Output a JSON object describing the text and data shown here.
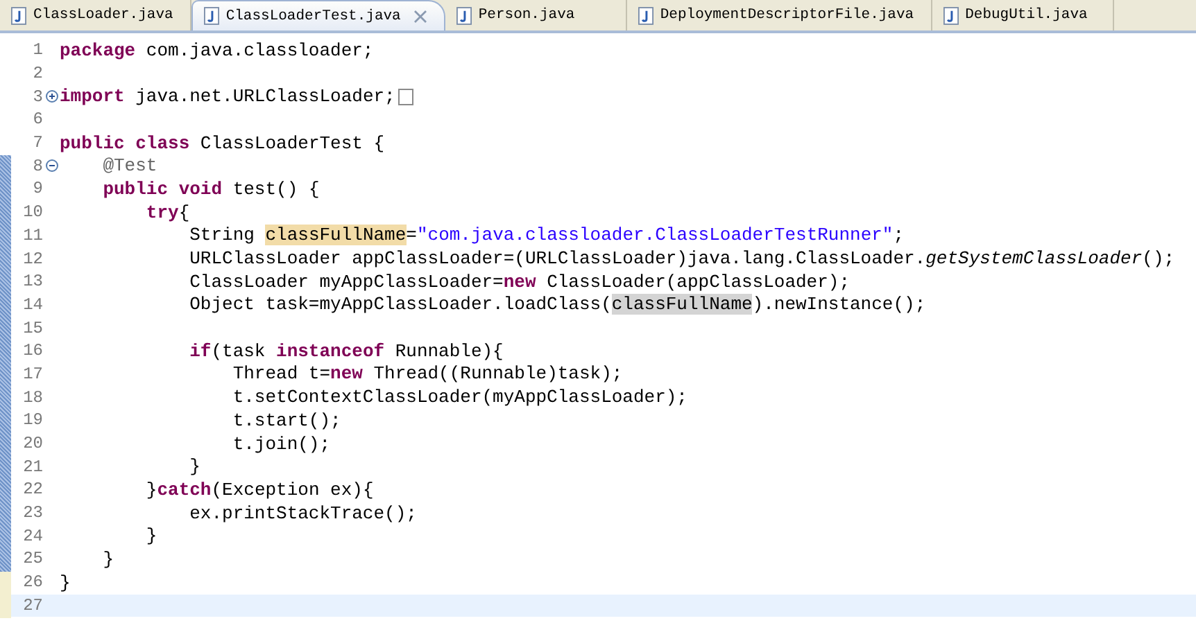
{
  "tabs": [
    {
      "label": "ClassLoader.java",
      "selected": false
    },
    {
      "label": "ClassLoaderTest.java",
      "selected": true
    },
    {
      "label": "Person.java",
      "selected": false
    },
    {
      "label": "DeploymentDescriptorFile.java",
      "selected": false
    },
    {
      "label": "DebugUtil.java",
      "selected": false
    }
  ],
  "editor": {
    "lines": [
      {
        "number": "1",
        "tokens": [
          {
            "kind": "keyword",
            "text": "package"
          },
          {
            "kind": "plain",
            "text": " com.java.classloader;"
          }
        ]
      },
      {
        "number": "2"
      },
      {
        "number": "3",
        "folded": true,
        "folded_marker": true,
        "tokens": [
          {
            "kind": "keyword",
            "text": "import"
          },
          {
            "kind": "plain",
            "text": " java.net.URLClassLoader;"
          }
        ]
      },
      {
        "number": "6"
      },
      {
        "number": "7",
        "tokens": [
          {
            "kind": "keyword",
            "text": "public class"
          },
          {
            "kind": "plain",
            "text": " ClassLoaderTest {"
          }
        ]
      },
      {
        "number": "8",
        "folded": false,
        "tokens": [
          {
            "kind": "annotation",
            "text": "    @Test"
          }
        ]
      },
      {
        "number": "9",
        "tokens": [
          {
            "kind": "keyword",
            "text": "    public void"
          },
          {
            "kind": "plain",
            "text": " test() {"
          }
        ]
      },
      {
        "number": "10",
        "tokens": [
          {
            "kind": "keyword",
            "text": "        try"
          },
          {
            "kind": "plain",
            "text": "{"
          }
        ]
      },
      {
        "number": "11",
        "tokens": [
          {
            "kind": "plain",
            "text": "            String "
          },
          {
            "kind": "occurrence-write",
            "text": "classFullName"
          },
          {
            "kind": "plain",
            "text": "="
          },
          {
            "kind": "string",
            "text": "\"com.java.classloader.ClassLoaderTestRunner\""
          },
          {
            "kind": "plain",
            "text": ";"
          }
        ]
      },
      {
        "number": "12",
        "tokens": [
          {
            "kind": "plain",
            "text": "            URLClassLoader appClassLoader=(URLClassLoader)java.lang.ClassLoader."
          },
          {
            "kind": "static",
            "text": "getSystemClassLoader"
          },
          {
            "kind": "plain",
            "text": "();"
          }
        ]
      },
      {
        "number": "13",
        "tokens": [
          {
            "kind": "plain",
            "text": "            ClassLoader myAppClassLoader="
          },
          {
            "kind": "keyword",
            "text": "new"
          },
          {
            "kind": "plain",
            "text": " ClassLoader(appClassLoader);"
          }
        ]
      },
      {
        "number": "14",
        "tokens": [
          {
            "kind": "plain",
            "text": "            Object task=myAppClassLoader.loadClass("
          },
          {
            "kind": "occurrence-read",
            "text": "classFullName"
          },
          {
            "kind": "plain",
            "text": ").newInstance();"
          }
        ]
      },
      {
        "number": "15"
      },
      {
        "number": "16",
        "tokens": [
          {
            "kind": "keyword",
            "text": "            if"
          },
          {
            "kind": "plain",
            "text": "(task "
          },
          {
            "kind": "keyword",
            "text": "instanceof"
          },
          {
            "kind": "plain",
            "text": " Runnable){"
          }
        ]
      },
      {
        "number": "17",
        "tokens": [
          {
            "kind": "plain",
            "text": "                Thread t="
          },
          {
            "kind": "keyword",
            "text": "new"
          },
          {
            "kind": "plain",
            "text": " Thread((Runnable)task);"
          }
        ]
      },
      {
        "number": "18",
        "tokens": [
          {
            "kind": "plain",
            "text": "                t.setContextClassLoader(myAppClassLoader);"
          }
        ]
      },
      {
        "number": "19",
        "tokens": [
          {
            "kind": "plain",
            "text": "                t.start();"
          }
        ]
      },
      {
        "number": "20",
        "tokens": [
          {
            "kind": "plain",
            "text": "                t.join();"
          }
        ]
      },
      {
        "number": "21",
        "tokens": [
          {
            "kind": "plain",
            "text": "            }"
          }
        ]
      },
      {
        "number": "22",
        "tokens": [
          {
            "kind": "plain",
            "text": "        }"
          },
          {
            "kind": "keyword",
            "text": "catch"
          },
          {
            "kind": "plain",
            "text": "(Exception ex){"
          }
        ]
      },
      {
        "number": "23",
        "tokens": [
          {
            "kind": "plain",
            "text": "            ex.printStackTrace();"
          }
        ]
      },
      {
        "number": "24",
        "tokens": [
          {
            "kind": "plain",
            "text": "        }"
          }
        ]
      },
      {
        "number": "25",
        "tokens": [
          {
            "kind": "plain",
            "text": "    }"
          }
        ]
      },
      {
        "number": "26",
        "tokens": [
          {
            "kind": "plain",
            "text": "}"
          }
        ]
      },
      {
        "number": "27",
        "current": true
      }
    ]
  }
}
